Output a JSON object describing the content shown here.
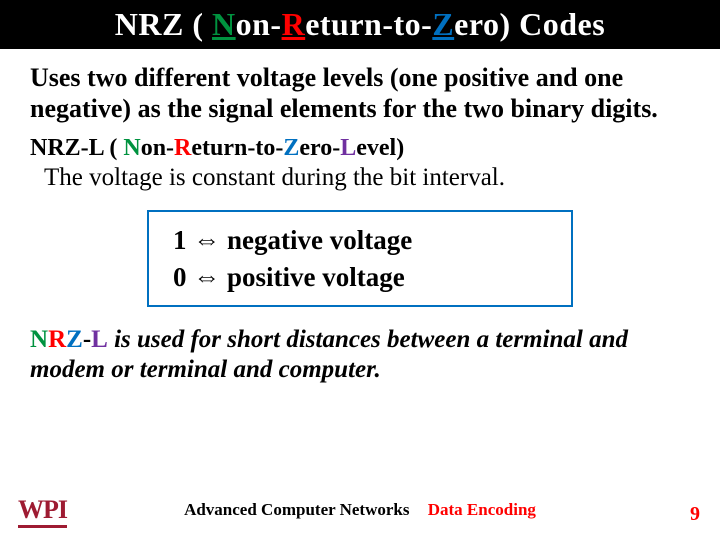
{
  "title": {
    "prefix": "NRZ ( ",
    "N": "N",
    "on_": "on-",
    "R": "R",
    "eturn_to_": "eturn-to-",
    "Z": "Z",
    "suffix": "ero) Codes"
  },
  "para1": "Uses two different voltage levels (one positive and one negative) as the signal elements for the two binary digits.",
  "nrzl_head": {
    "prefix": "NRZ-L ( ",
    "N": "N",
    "on_": "on-",
    "R": "R",
    "eturn_to_": "eturn-to-",
    "Z": "Z",
    "ero_": "ero-",
    "L": "L",
    "suffix": "evel)"
  },
  "nrzl_sub": "The voltage is constant during the bit interval.",
  "box": {
    "line1_a": "1 ",
    "arrow": "⇔",
    "line1_b": "  negative voltage",
    "line2_a": "0 ",
    "line2_b": "  positive  voltage"
  },
  "para2": {
    "nrzl": "NRZ-L",
    "rest": " is used for short distances between a terminal and modem or terminal and computer."
  },
  "footer": {
    "logo": "WPI",
    "course": "Advanced Computer Networks",
    "topic": "Data Encoding",
    "page": "9"
  }
}
